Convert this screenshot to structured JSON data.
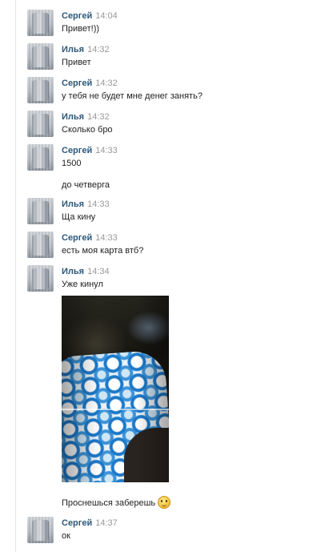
{
  "messages": [
    {
      "author": "Сергей",
      "time": "14:04",
      "lines": [
        "Привет!))"
      ]
    },
    {
      "author": "Илья",
      "time": "14:32",
      "lines": [
        "Привет"
      ]
    },
    {
      "author": "Сергей",
      "time": "14:32",
      "lines": [
        "у тебя не будет мне денег занять?"
      ]
    },
    {
      "author": "Илья",
      "time": "14:32",
      "lines": [
        "Сколько бро"
      ]
    },
    {
      "author": "Сергей",
      "time": "14:33",
      "lines": [
        "1500",
        "до четверга"
      ]
    },
    {
      "author": "Илья",
      "time": "14:33",
      "lines": [
        "Ща кину"
      ]
    },
    {
      "author": "Сергей",
      "time": "14:33",
      "lines": [
        "есть моя карта втб?"
      ]
    },
    {
      "author": "Илья",
      "time": "14:34",
      "lines": [
        "Уже кинул",
        "Проснешься заберешь"
      ],
      "attachment": "photo",
      "emoji": "wink-smiley-icon"
    },
    {
      "author": "Сергей",
      "time": "14:37",
      "lines": [
        "ок"
      ]
    }
  ],
  "colors": {
    "author": "#2b587a",
    "time": "#999999",
    "text": "#222222",
    "divider": "#e3e6ea"
  }
}
